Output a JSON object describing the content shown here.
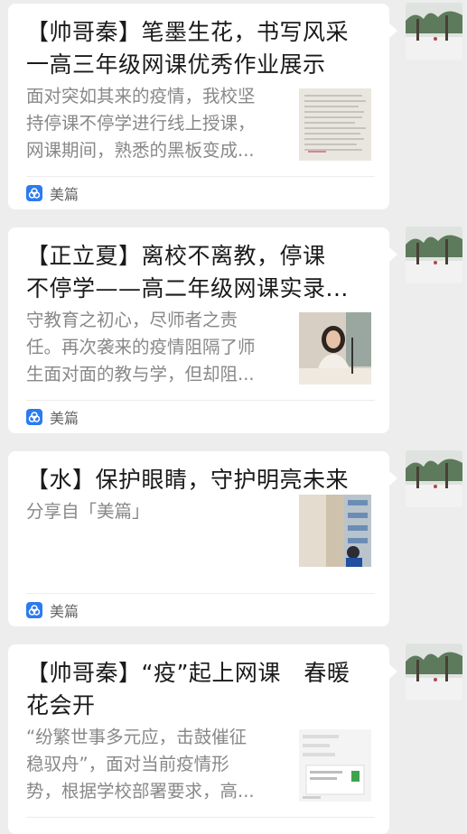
{
  "messages": [
    {
      "title": "【帅哥秦】笔墨生花，书写风采一高三年级网课优秀作业展示",
      "title_lines": [
        "【帅哥秦】笔墨生花，书写风采",
        "一高三年级网课优秀作业展示"
      ],
      "desc_lines": [
        "面对突如其来的疫情，我校坚",
        "持停课不停学进行线上授课，",
        "网课期间，熟悉的黑板变成..."
      ],
      "source": "美篇",
      "thumb": "handwritten-notebook"
    },
    {
      "title_lines": [
        "【正立夏】离校不离教，停课",
        "不停学——高二年级网课实录..."
      ],
      "desc_lines": [
        "守教育之初心，尽师者之责",
        "任。再次袭来的疫情阻隔了师",
        "生面对面的教与学，但却阻..."
      ],
      "source": "美篇",
      "thumb": "teacher-at-desk"
    },
    {
      "title_lines": [
        "【水】保护眼睛，守护明亮未来"
      ],
      "desc_lines": [
        "分享自「美篇」"
      ],
      "source": "美篇",
      "thumb": "child-reading-bookshelf"
    },
    {
      "title_lines": [
        "【帅哥秦】“疫”起上网课　春暖",
        "花会开"
      ],
      "desc_lines": [
        "“纷繁世事多元应，击鼓催征",
        "稳驭舟”，面对当前疫情形",
        "势，根据学校部署要求，高..."
      ],
      "source": "美篇",
      "thumb": "chat-screenshot"
    }
  ],
  "colors": {
    "background": "#ededed",
    "card": "#ffffff",
    "title": "#1a1a1a",
    "desc": "#888888",
    "source_icon": "#2b7bf0"
  },
  "icons": {
    "source": "meipian-logo-icon",
    "avatar": "snowy-tree-avatar"
  }
}
